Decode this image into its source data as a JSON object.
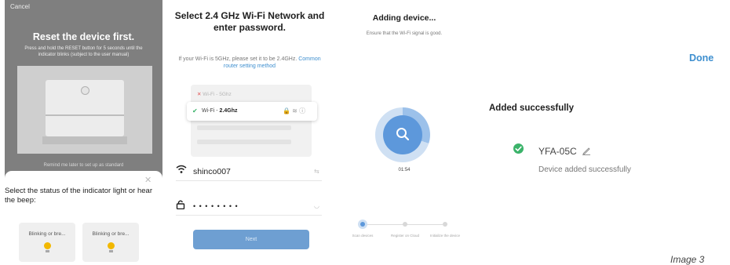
{
  "panel1": {
    "cancel_label": "Cancel",
    "title": "Reset the device first.",
    "description": "Press and hold the RESET button for 5 seconds until the indicator blinks (subject to the user manual)",
    "remind_label": "Remind me later to set up  as standard",
    "sheet_question": "Select the status of the indicator light or hear the beep:",
    "options": [
      {
        "label": "Blinking or bre..."
      },
      {
        "label": "Blinking or bre..."
      }
    ],
    "bulb_color": "#f2b800"
  },
  "panel2": {
    "title": "Select 2.4 GHz Wi-Fi Network and enter password.",
    "sub_text": "If your Wi-Fi is 5GHz, please set it to be 2.4GHz.",
    "sub_link": "Common router setting method",
    "networks": [
      {
        "name": "Wi-Fi - 5Ghz"
      },
      {
        "name": "Wi-Fi - ",
        "band": "2.4Ghz"
      }
    ],
    "ssid_value": "shinco007",
    "password_mask": "• • • • • • • •",
    "next_label": "Next",
    "accent_color": "#3e8fcf"
  },
  "panel3": {
    "title": "Adding device...",
    "sub": "Ensure that the Wi-Fi signal is good.",
    "timer": "01:54",
    "progress_fraction": 0.3,
    "steps": [
      {
        "label": "Scan devices",
        "active": true
      },
      {
        "label": "Register on Cloud",
        "active": false
      },
      {
        "label": "Initialize the device",
        "active": false
      }
    ]
  },
  "panel4": {
    "done_label": "Done",
    "heading": "Added successfully",
    "device_name": "YFA-05C",
    "device_status": "Device added successfully",
    "success_color": "#3bb36a"
  },
  "caption": "Image 3"
}
